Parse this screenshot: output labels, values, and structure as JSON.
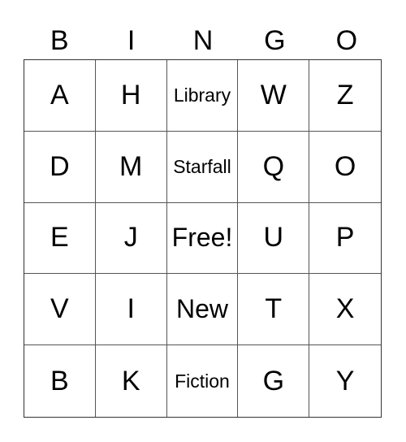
{
  "header": [
    "B",
    "I",
    "N",
    "G",
    "O"
  ],
  "cells": [
    [
      "A",
      "H",
      "Library",
      "W",
      "Z"
    ],
    [
      "D",
      "M",
      "Starfall",
      "Q",
      "O"
    ],
    [
      "E",
      "J",
      "Free!",
      "U",
      "P"
    ],
    [
      "V",
      "I",
      "New",
      "T",
      "X"
    ],
    [
      "B",
      "K",
      "Fiction",
      "G",
      "Y"
    ]
  ]
}
